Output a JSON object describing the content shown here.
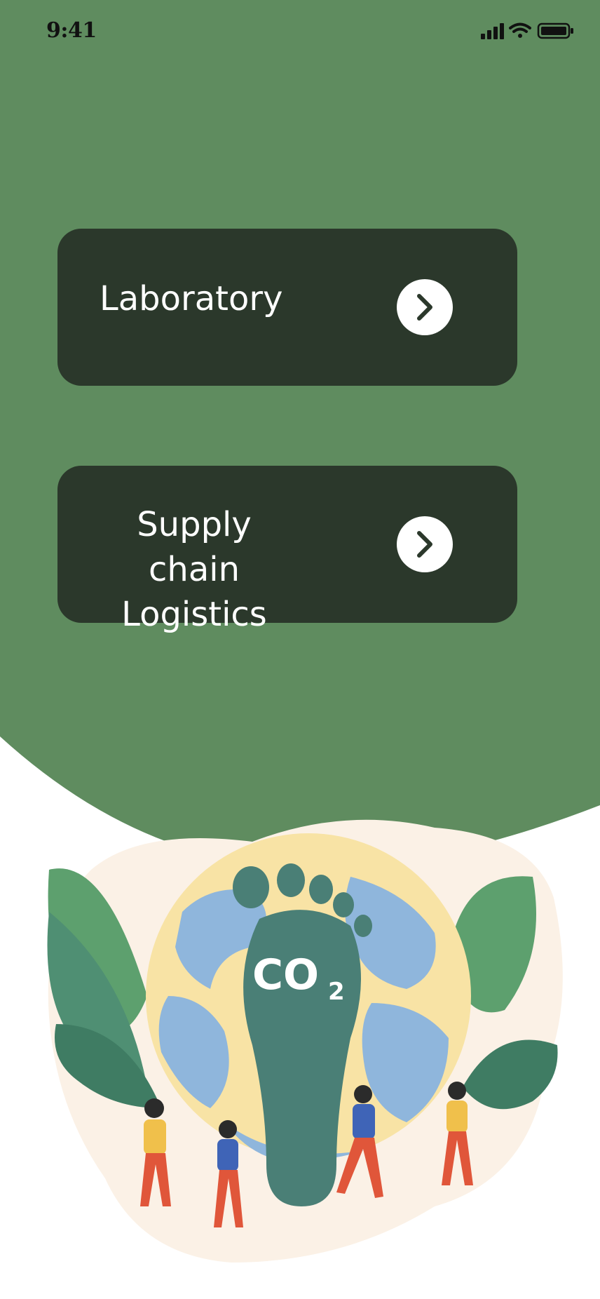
{
  "status_bar": {
    "time": "9:41"
  },
  "menu": {
    "items": [
      {
        "label": "Laboratory",
        "icon": "chevron-right-icon"
      },
      {
        "label": "Supply chain\nLogistics",
        "icon": "chevron-right-icon"
      }
    ]
  },
  "illustration": {
    "badge_text": "CO",
    "badge_subscript": "2"
  },
  "colors": {
    "header_green": "#5f8c5f",
    "card_dark": "#2b382b",
    "white": "#ffffff"
  }
}
